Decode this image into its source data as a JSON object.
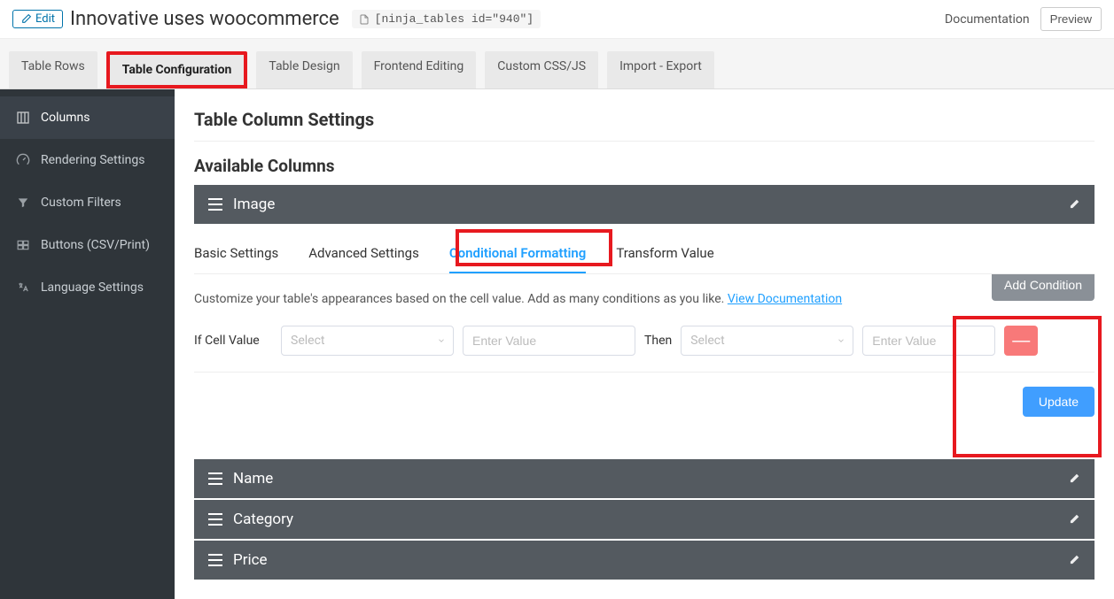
{
  "header": {
    "edit_label": "Edit",
    "title": "Innovative uses woocommerce",
    "shortcode": "[ninja_tables id=\"940\"]",
    "documentation": "Documentation",
    "preview": "Preview"
  },
  "tabs": [
    {
      "label": "Table Rows"
    },
    {
      "label": "Table Configuration"
    },
    {
      "label": "Table Design"
    },
    {
      "label": "Frontend Editing"
    },
    {
      "label": "Custom CSS/JS"
    },
    {
      "label": "Import - Export"
    }
  ],
  "sidebar": {
    "items": [
      {
        "label": "Columns",
        "icon": "columns-icon"
      },
      {
        "label": "Rendering Settings",
        "icon": "tachometer-icon"
      },
      {
        "label": "Custom Filters",
        "icon": "filter-icon"
      },
      {
        "label": "Buttons (CSV/Print)",
        "icon": "buttons-icon"
      },
      {
        "label": "Language Settings",
        "icon": "language-icon"
      }
    ]
  },
  "content": {
    "section_title": "Table Column Settings",
    "sub_title": "Available Columns"
  },
  "expanded_column": {
    "name": "Image",
    "inner_tabs": [
      {
        "label": "Basic Settings"
      },
      {
        "label": "Advanced Settings"
      },
      {
        "label": "Conditional Formatting"
      },
      {
        "label": "Transform Value"
      }
    ],
    "description": "Customize your table's appearances based on the cell value. Add as many conditions as you like.",
    "doc_link_text": "View Documentation",
    "add_condition": "Add Condition",
    "if_label": "If Cell Value",
    "then_label": "Then",
    "select_placeholder": "Select",
    "value_placeholder": "Enter Value",
    "update": "Update"
  },
  "other_columns": [
    {
      "name": "Name"
    },
    {
      "name": "Category"
    },
    {
      "name": "Price"
    }
  ]
}
